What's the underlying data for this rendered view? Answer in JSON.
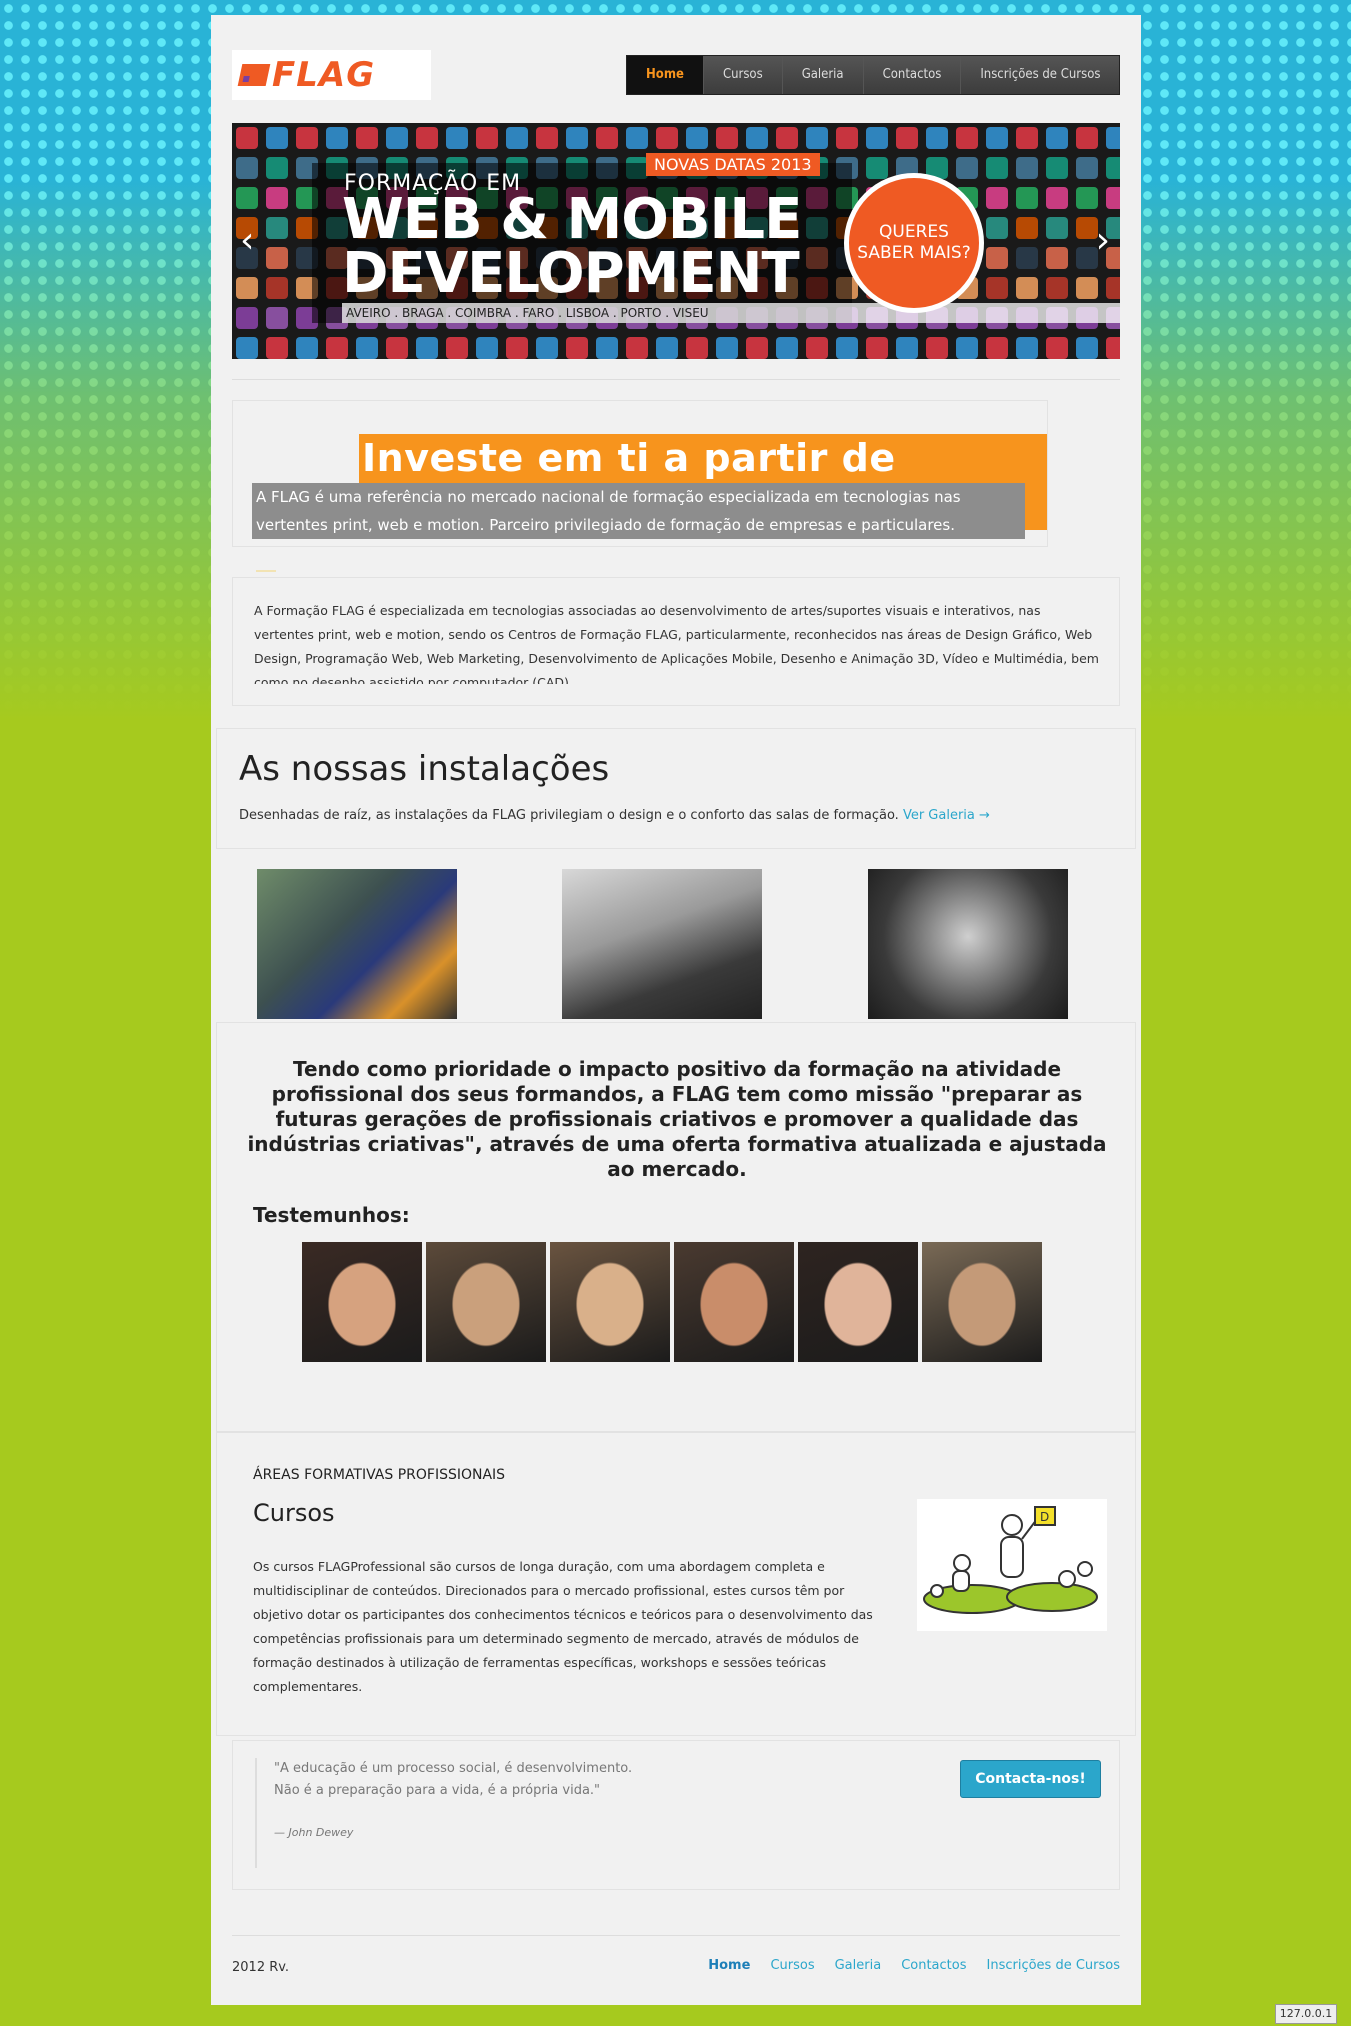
{
  "header": {
    "logo_text": "FLAG",
    "nav": [
      {
        "label": "Home",
        "active": true
      },
      {
        "label": "Cursos",
        "active": false
      },
      {
        "label": "Galeria",
        "active": false
      },
      {
        "label": "Contactos",
        "active": false
      },
      {
        "label": "Inscrições de Cursos",
        "active": false
      }
    ]
  },
  "banner": {
    "badge": "NOVAS DATAS 2013",
    "subtitle": "FORMAÇÃO EM",
    "headline_line1": "WEB & MOBILE",
    "headline_line2": "DEVELOPMENT",
    "cities": "AVEIRO . BRAGA . COIMBRA . FARO . LISBOA . PORTO . VISEU",
    "cta_line1": "QUERES",
    "cta_line2": "SABER MAIS?",
    "prev_icon": "chevron-left-icon",
    "next_icon": "chevron-right-icon"
  },
  "hero": {
    "title": "Investe em ti a partir de hoje...",
    "subtitle": "A FLAG é uma referência no mercado nacional de formação especializada em tecnologias nas vertentes print, web e motion. Parceiro privilegiado de formação de empresas e particulares."
  },
  "about": {
    "text": "A Formação FLAG é especializada em tecnologias associadas ao desenvolvimento de artes/suportes visuais e interativos, nas vertentes print, web e motion, sendo os Centros de Formação FLAG, particularmente, reconhecidos nas áreas de Design Gráfico, Web Design, Programação Web, Web Marketing, Desenvolvimento de Aplicações Mobile, Desenho e Animação 3D, Vídeo e Multimédia, bem como no desenho assistido por computador (CAD)."
  },
  "facilities": {
    "title": "As nossas instalações",
    "description": "Desenhadas de raíz, as instalações da FLAG privilegiam o design e o conforto das salas de formação.",
    "gallery_link": "Ver Galeria →"
  },
  "mission": {
    "text": "Tendo como prioridade o impacto positivo da formação na atividade profissional dos seus formandos, a FLAG tem como missão \"preparar as futuras gerações de profissionais criativos e promover a qualidade das indústrias criativas\", através de uma oferta formativa atualizada e ajustada ao mercado."
  },
  "testimonials": {
    "title": "Testemunhos:",
    "count": 6
  },
  "areas": {
    "kicker": "ÁREAS FORMATIVAS PROFISSIONAIS",
    "title": "Cursos",
    "text": "Os cursos FLAGProfessional são cursos de longa duração, com uma abordagem completa e multidisciplinar de conteúdos. Direcionados para o mercado profissional, estes cursos têm por objetivo dotar os participantes dos conhecimentos técnicos e teóricos para o desenvolvimento das competências profissionais para um determinado segmento de mercado, através de módulos de formação destinados à utilização de ferramentas específicas, workshops e sessões teóricas complementares."
  },
  "quote": {
    "line1": "\"A educação é um processo social, é desenvolvimento.",
    "line2": "Não é a preparação para a vida, é a própria vida.\"",
    "author": "— John Dewey",
    "button": "Contacta-nos!"
  },
  "footer": {
    "copyright": "2012 Rv.",
    "links": [
      "Home",
      "Cursos",
      "Galeria",
      "Contactos",
      "Inscrições de Cursos"
    ]
  },
  "host_badge": "127.0.0.1",
  "colors": {
    "brand_orange": "#ef5a23",
    "highlight_orange": "#f7941d",
    "link_blue": "#2ba6cb",
    "background_green": "#a6ca1e",
    "background_blue": "#29b3d6"
  }
}
